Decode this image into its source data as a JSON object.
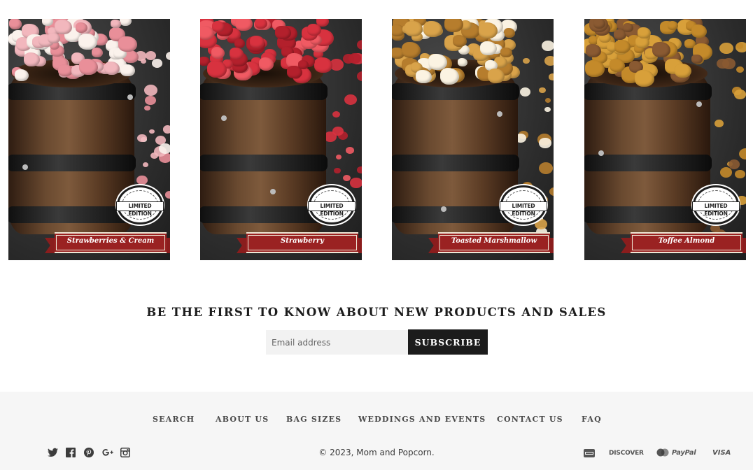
{
  "products": [
    {
      "name": "Strawberries & Cream",
      "badge": "LIMITED EDITION",
      "colors": {
        "kernel_a": "#f2b7bd",
        "kernel_b": "#fbf2ec",
        "kernel_c": "#e98f99"
      }
    },
    {
      "name": "Strawberry",
      "badge": "LIMITED EDITION",
      "colors": {
        "kernel_a": "#d8323f",
        "kernel_b": "#f05a63",
        "kernel_c": "#b3202c"
      }
    },
    {
      "name": "Toasted Marshmallow",
      "badge": "LIMITED EDITION",
      "colors": {
        "kernel_a": "#d9a34a",
        "kernel_b": "#fbf3e2",
        "kernel_c": "#b67d2d"
      }
    },
    {
      "name": "Toffee Almond",
      "badge": "LIMITED EDITION",
      "colors": {
        "kernel_a": "#d8a03a",
        "kernel_b": "#c48a2a",
        "kernel_c": "#8a5a32"
      }
    }
  ],
  "newsletter": {
    "heading": "BE THE FIRST TO KNOW ABOUT NEW PRODUCTS AND SALES",
    "email_placeholder": "Email address",
    "subscribe_label": "SUBSCRIBE"
  },
  "footer": {
    "nav": [
      "SEARCH",
      "ABOUT US",
      "BAG SIZES",
      "WEDDINGS AND EVENTS",
      "CONTACT US",
      "FAQ"
    ],
    "social_icons": [
      "twitter-icon",
      "facebook-icon",
      "pinterest-icon",
      "google-plus-icon",
      "instagram-icon"
    ],
    "copyright_prefix": "© 2023,",
    "copyright_brand": "Mom and Popcorn",
    "copyright_suffix": ".",
    "payments": [
      "AMEX",
      "DISCOVER",
      "MASTERCARD",
      "PayPal",
      "VISA"
    ]
  },
  "theme": {
    "accent": "#9a2222",
    "dark": "#1c1c1c",
    "footer_bg": "#f6f6f6"
  }
}
